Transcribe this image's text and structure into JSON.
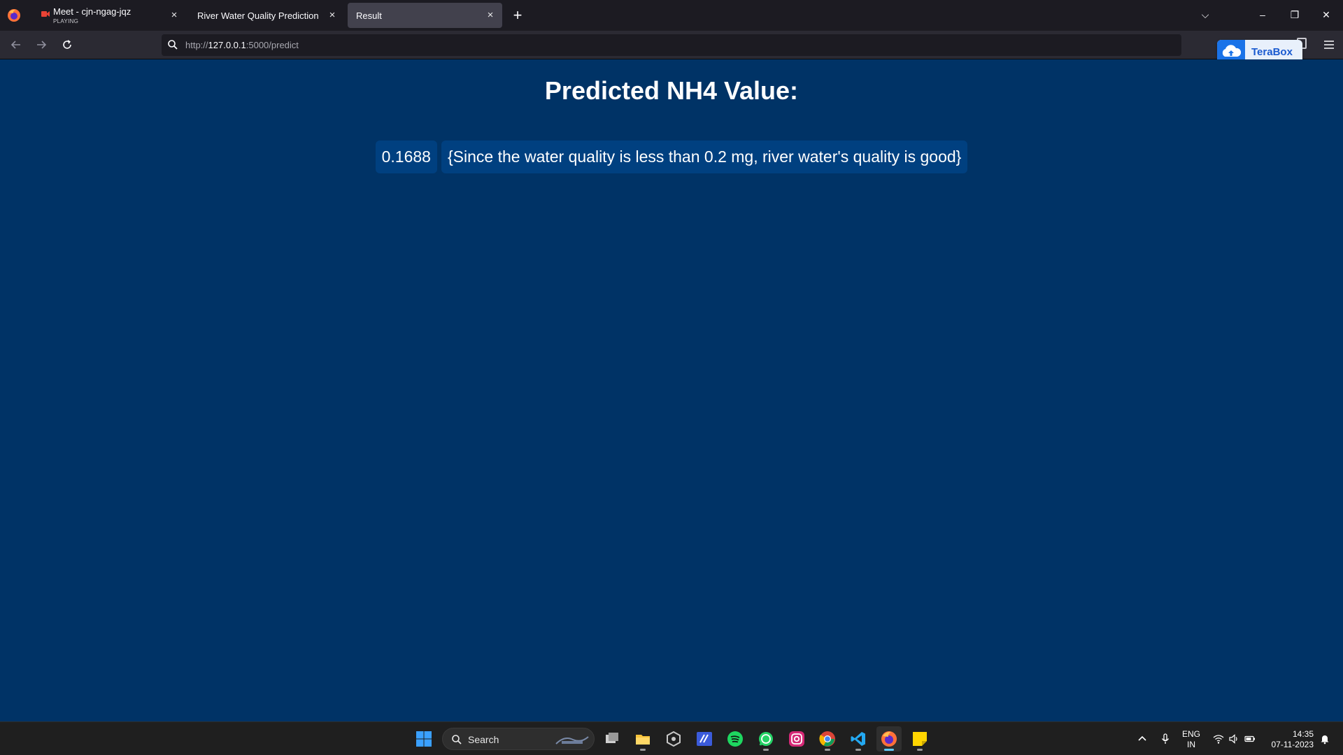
{
  "browser": {
    "tabs": [
      {
        "title": "Meet - cjn-ngag-jqz",
        "subtitle": "PLAYING",
        "close": "×"
      },
      {
        "title": "River Water Quality Prediction",
        "close": "×"
      },
      {
        "title": "Result",
        "close": "×",
        "active": true
      }
    ],
    "new_tab": "+",
    "url": {
      "scheme": "http://",
      "host": "127.0.0.1",
      "path": ":5000/predict"
    },
    "window_controls": {
      "list_all_tabs": "⌵",
      "minimize": "–",
      "restore": "❐",
      "close": "✕"
    }
  },
  "extension": {
    "label": "TeraBox",
    "color": "#1a73e8"
  },
  "page": {
    "title": "Predicted NH4 Value:",
    "value": "0.1688",
    "message": "{Since the water quality is less than 0.2 mg, river water's quality is good}",
    "background": "#003366",
    "pill_color": "#004080"
  },
  "taskbar": {
    "search_label": "Search",
    "apps": [
      "start-icon",
      "task-view-icon",
      "file-explorer-icon",
      "app-icon",
      "pen-app-icon",
      "spotify-icon",
      "whatsapp-icon",
      "instagram-icon",
      "chrome-icon",
      "vscode-icon",
      "firefox-icon",
      "sticky-notes-icon"
    ],
    "language": {
      "line1": "ENG",
      "line2": "IN"
    },
    "clock": {
      "time": "14:35",
      "date": "07-11-2023"
    }
  }
}
